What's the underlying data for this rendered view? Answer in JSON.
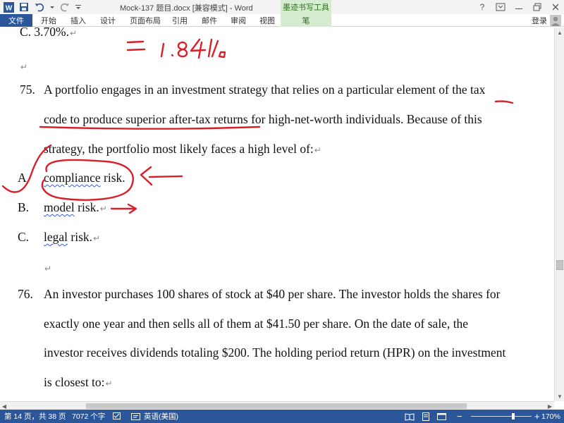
{
  "window": {
    "title": "Mock-137 题目.docx [兼容模式] - Word",
    "help": "?",
    "controls": [
      "ribbon-options",
      "minimize",
      "restore",
      "close"
    ]
  },
  "ribbon": {
    "file_tab": "文件",
    "tabs": [
      "开始",
      "插入",
      "设计",
      "页面布局",
      "引用",
      "邮件",
      "审阅",
      "视图"
    ],
    "contextual_group": "墨迹书写工具",
    "contextual_tab": "笔",
    "sign_in": "登录"
  },
  "document": {
    "prev_fragment": "C.   3.70%.",
    "q75": {
      "number": "75.",
      "lines": [
        "A portfolio engages in an investment strategy that relies on a particular element of the tax",
        "code to produce superior after-tax returns for high-net-worth individuals. Because of this",
        "strategy, the portfolio most likely faces a high level of:"
      ],
      "options": [
        {
          "letter": "A.",
          "word": "compliance",
          "rest": " risk."
        },
        {
          "letter": "B.",
          "word": "model",
          "rest": " risk."
        },
        {
          "letter": "C.",
          "word": "legal",
          "rest": " risk."
        }
      ]
    },
    "q76": {
      "number": "76.",
      "lines": [
        "An investor purchases 100 shares of stock at $40 per share. The investor holds the shares for",
        "exactly one year and then sells all of them at $41.50 per share. On the date of sale, the",
        "investor receives dividends totaling $200. The holding period return (HPR) on the investment",
        "is closest to:"
      ]
    },
    "paragraph_mark": "↵"
  },
  "handwriting": {
    "note": "= 1.84%",
    "ink_color": "#d8202a"
  },
  "status_bar": {
    "page": "第 14 页，共 38 页",
    "words": "7072 个字",
    "language": "英语(美国)",
    "zoom": "170%",
    "zoom_level": 0.7
  },
  "colors": {
    "accent": "#2b579a",
    "contextual": "#d6ecd0",
    "squiggle": "#3a5bd8"
  }
}
